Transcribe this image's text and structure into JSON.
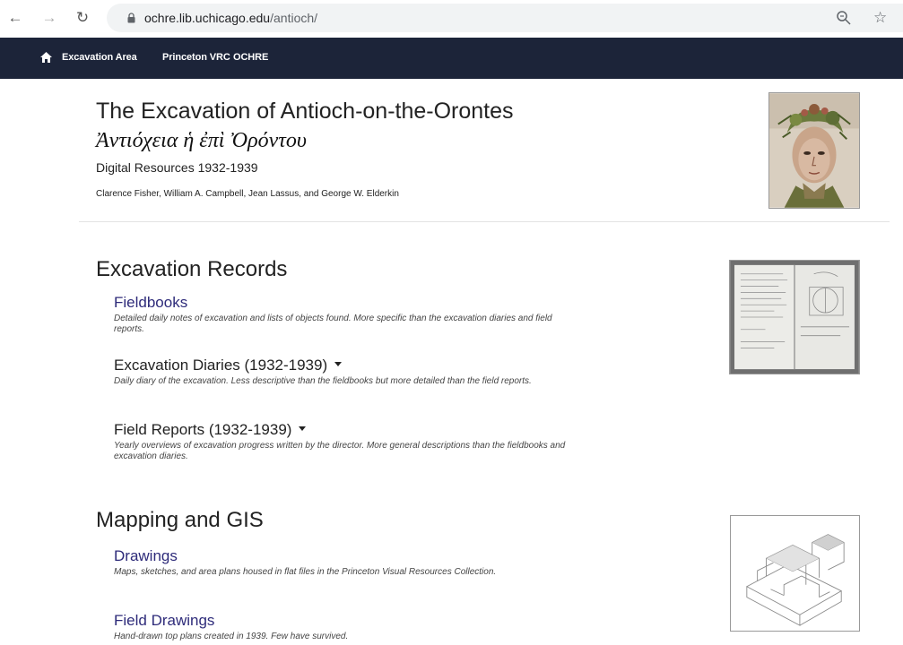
{
  "browser": {
    "url_host": "ochre.lib.uchicago.edu",
    "url_path": "/antioch/"
  },
  "navbar": {
    "items": [
      {
        "label": "Excavation Area"
      },
      {
        "label": "Princeton VRC"
      },
      {
        "label": "OCHRE"
      }
    ]
  },
  "header": {
    "title": "The Excavation of Antioch-on-the-Orontes",
    "greek_title": "Ἀντιόχεια ἡ ἐπὶ Ὀρόντου",
    "subtitle": "Digital Resources 1932-1939",
    "authors": "Clarence Fisher, William A. Campbell, Jean Lassus, and George W. Elderkin"
  },
  "sections": [
    {
      "title": "Excavation Records",
      "items": [
        {
          "label": "Fieldbooks",
          "type": "link",
          "description": "Detailed daily notes of excavation and lists of objects found. More specific than the excavation diaries and field reports."
        },
        {
          "label": "Excavation Diaries (1932-1939)",
          "type": "dropdown",
          "description": "Daily diary of the excavation. Less descriptive than the fieldbooks but more detailed than the field reports."
        },
        {
          "label": "Field Reports (1932-1939)",
          "type": "dropdown",
          "description": "Yearly overviews of excavation progress written by the director. More general descriptions than the fieldbooks and excavation diaries."
        }
      ]
    },
    {
      "title": "Mapping and GIS",
      "items": [
        {
          "label": "Drawings",
          "type": "link",
          "description": "Maps, sketches, and area plans housed in flat files in the Princeton Visual Resources Collection."
        },
        {
          "label": "Field Drawings",
          "type": "link",
          "description": "Hand-drawn top plans created in 1939. Few have survived."
        }
      ]
    }
  ],
  "colors": {
    "navbar_bg": "#1c2439",
    "link": "#2e2b7a"
  },
  "icons": [
    "back-arrow-icon",
    "forward-arrow-icon",
    "reload-icon",
    "lock-icon",
    "zoom-icon",
    "star-icon",
    "home-icon"
  ]
}
